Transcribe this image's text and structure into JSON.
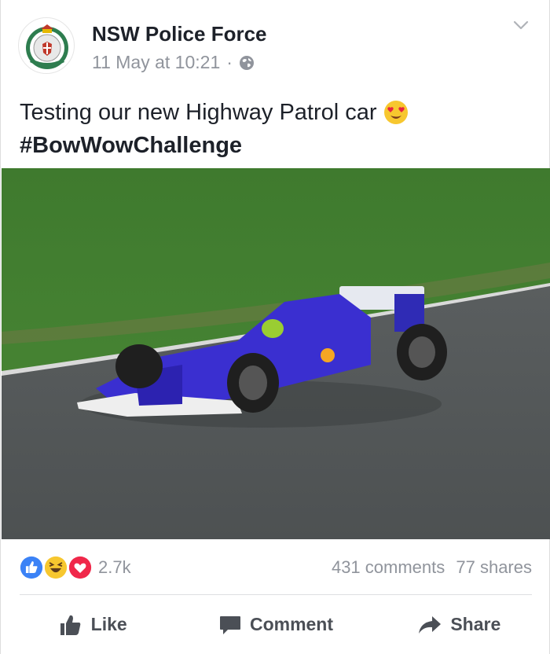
{
  "post": {
    "author": "NSW Police Force",
    "timestamp": "11 May at 10:21",
    "separator": "·",
    "privacy_icon": "globe-icon",
    "text_line1": "Testing our new Highway Patrol car",
    "emoji": "heart-eyes-emoji",
    "hashtag": "#BowWowChallenge"
  },
  "stats": {
    "reaction_icons": [
      "like-reaction-icon",
      "haha-reaction-icon",
      "love-reaction-icon"
    ],
    "reaction_count": "2.7k",
    "comments": "431 comments",
    "shares": "77 shares"
  },
  "actions": {
    "like": "Like",
    "comment": "Comment",
    "share": "Share"
  },
  "colors": {
    "brand_blue": "#4267b2",
    "like_blue": "#3b82f6",
    "love_red": "#f0284a",
    "haha_yellow": "#f7c72f",
    "muted_text": "#90949c",
    "action_text": "#4b4f56"
  }
}
